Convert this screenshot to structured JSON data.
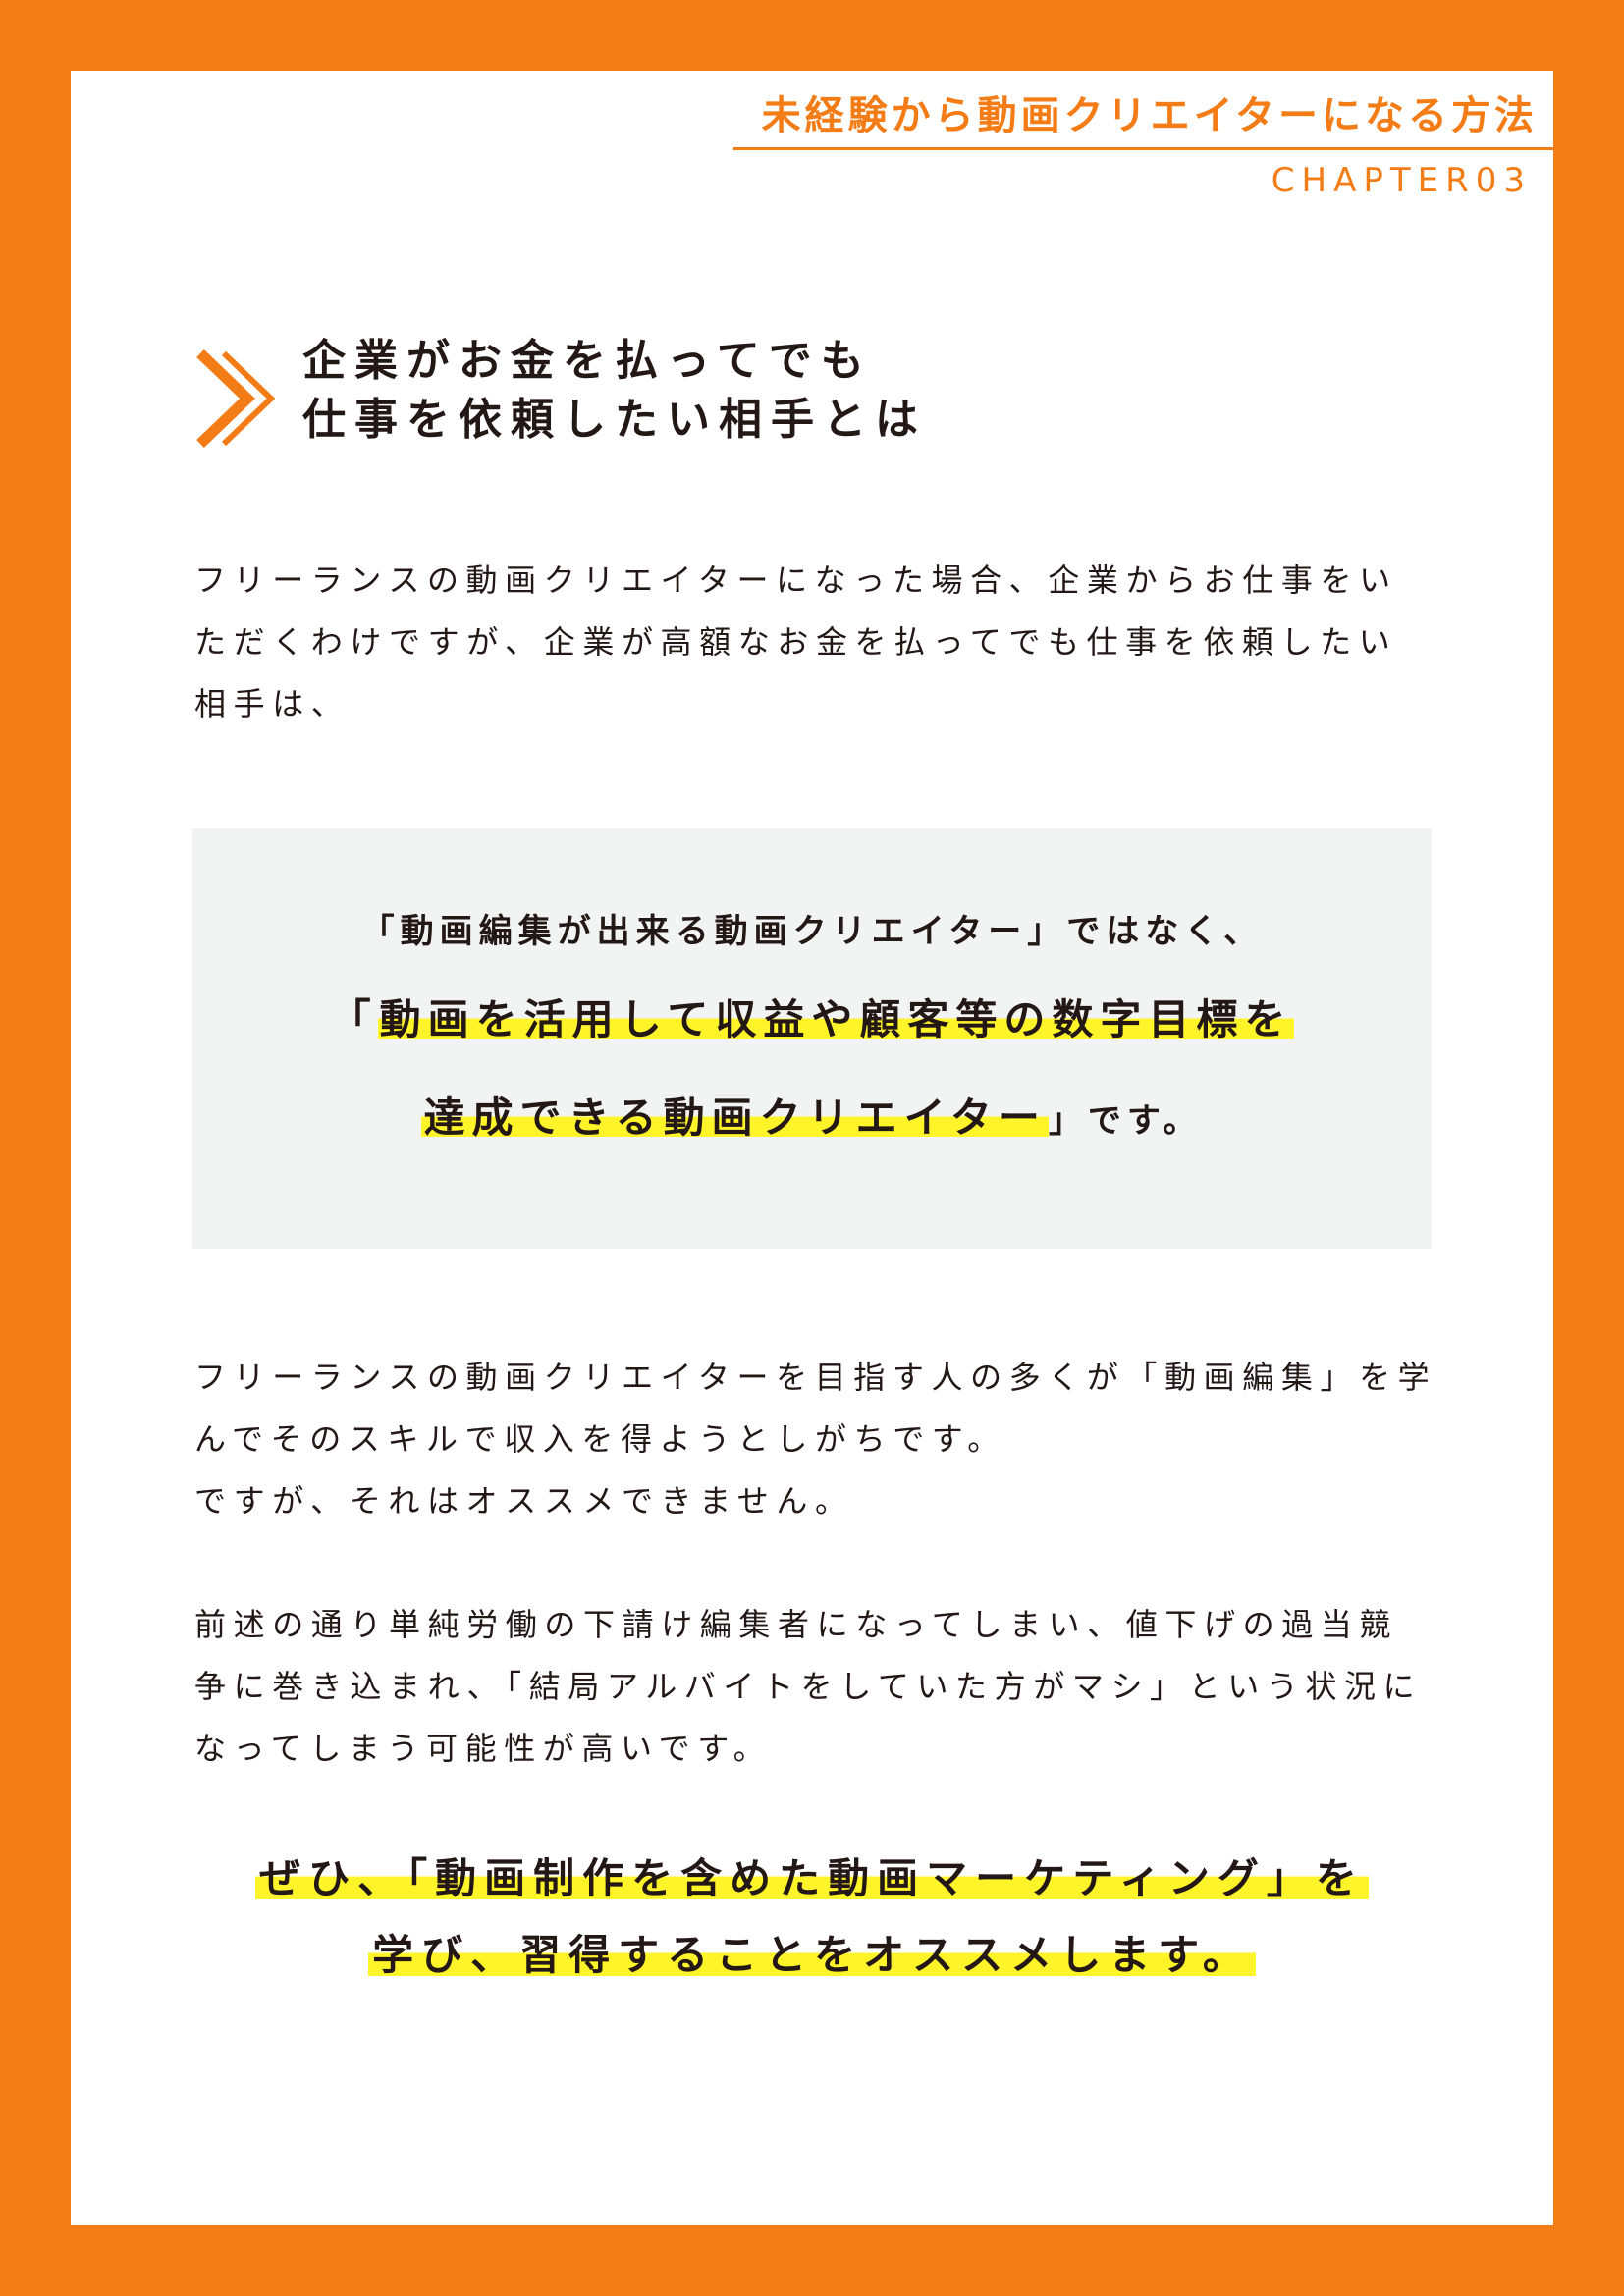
{
  "header": {
    "title": "未経験から動画クリエイターになる方法",
    "chapter": "CHAPTER03"
  },
  "section": {
    "icon": "double-chevron-right-icon",
    "heading_line1": "企業がお金を払ってでも",
    "heading_line2": "仕事を依頼したい相手とは"
  },
  "intro": {
    "lines": [
      "フリーランスの動画クリエイターになった場合、企業からお仕事をい",
      "ただくわけですが、企業が高額なお金を払ってでも仕事を依頼したい",
      "相手は、"
    ]
  },
  "callout": {
    "line1": "「動画編集が出来る動画クリエイター」ではなく、",
    "line2_open": "「",
    "line2_highlight": "動画を活用して収益や顧客等の数字目標を",
    "line3_highlight": "達成できる動画クリエイター",
    "line3_tail": "」です。"
  },
  "body2": {
    "lines": [
      "フリーランスの動画クリエイターを目指す人の多くが「動画編集」を学",
      "んでそのスキルで収入を得ようとしがちです。",
      "ですが、それはオススメできません。"
    ]
  },
  "body3": {
    "lines": [
      "前述の通り単純労働の下請け編集者になってしまい、値下げの過当競",
      "争に巻き込まれ、「結局アルバイトをしていた方がマシ」という状況に",
      "なってしまう可能性が高いです。"
    ]
  },
  "closing": {
    "line1": "ぜひ、「動画制作を含めた動画マーケティング」を",
    "line2": "学び、習得することをオススメします。"
  },
  "colors": {
    "accent": "#f47c16",
    "highlight": "#fff42a",
    "callout_bg": "#f2f4f4",
    "text": "#231815"
  }
}
